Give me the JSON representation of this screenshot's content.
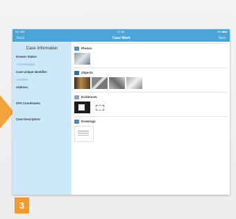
{
  "statusbar": {
    "carrier": "No SIM",
    "time": "07:46",
    "battery": "5% ■■■"
  },
  "navbar": {
    "back_label": "Back",
    "title": "Case Work",
    "next_label": "Next"
  },
  "sidebar": {
    "title": "Case Information",
    "fields": [
      {
        "label": "Dossier Status:",
        "value": "Acknowledged"
      },
      {
        "label": "Case Unique Identifier:",
        "value": "casetest7"
      },
      {
        "label": "Address:",
        "value": ""
      },
      {
        "label": "GPS Coordinates:",
        "value": ""
      },
      {
        "label": "Case Description:",
        "value": ""
      }
    ]
  },
  "sections": [
    {
      "title": "Photos",
      "icon": "photo-icon",
      "color": "#5a89c6"
    },
    {
      "title": "Objects",
      "icon": "objects-icon",
      "color": "#2c6cb3"
    },
    {
      "title": "Evidences",
      "icon": "evidence-icon",
      "color": "#8aa0b4"
    },
    {
      "title": "Drawings",
      "icon": "drawing-icon",
      "color": "#4d86c4"
    }
  ],
  "step_number": "3",
  "colors": {
    "accent": "#4aa5db",
    "sidebar_bg": "#cde8f8",
    "marker": "#f39a2c"
  }
}
